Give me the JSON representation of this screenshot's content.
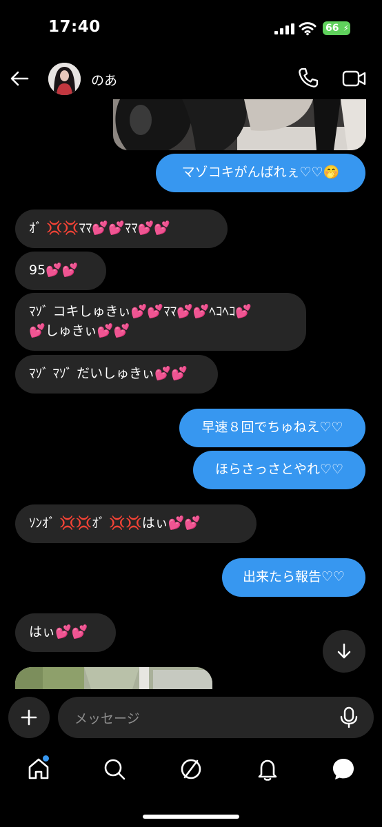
{
  "status": {
    "time": "17:40",
    "battery": "66"
  },
  "header": {
    "name": "のあ"
  },
  "messages": {
    "m1": "マゾコキがんばれぇ♡♡🤭",
    "m2": "ｵﾞ 💢💢ﾏﾏ💕💕ﾏﾏ💕💕",
    "m3": "95💕💕",
    "m4": "ﾏｿﾞ コキしゅきぃ💕💕ﾏﾏ💕💕ﾍｺﾍｺ💕\n💕しゅきぃ💕💕",
    "m5": "ﾏｿﾞ ﾏｿﾞ だいしゅきぃ💕💕",
    "m6": "早速８回でちゅねえ♡♡",
    "m7": "ほらさっさとやれ♡♡",
    "m8": "ｿﾝｵﾞ 💢💢ｵﾞ 💢💢はぃ💕💕",
    "m9": "出来たら報告♡♡",
    "m10": "はぃ💕💕"
  },
  "composer": {
    "placeholder": "メッセージ"
  },
  "icons": {
    "back": "arrow-left-icon",
    "call": "phone-icon",
    "video": "video-camera-icon",
    "scroll": "arrow-down-icon",
    "add": "plus-icon",
    "mic": "microphone-icon",
    "tabs": [
      "home-icon",
      "search-icon",
      "compass-icon",
      "bell-icon",
      "chat-bubble-icon"
    ]
  },
  "colors": {
    "outgoing": "#3797f0",
    "incoming": "#262626",
    "background": "#000000",
    "battery": "#5fd15c"
  }
}
